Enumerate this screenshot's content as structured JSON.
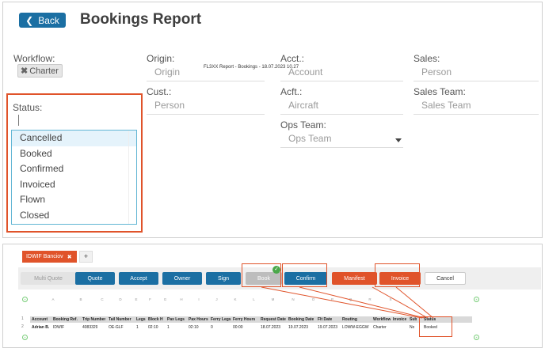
{
  "header": {
    "back_label": "Back",
    "title": "Bookings Report"
  },
  "filters": {
    "workflow_label": "Workflow:",
    "workflow_chip": "Charter",
    "origin_label": "Origin:",
    "origin_placeholder": "Origin",
    "cust_label": "Cust.:",
    "cust_placeholder": "Person",
    "acct_label": "Acct.:",
    "acct_placeholder": "Account",
    "acft_label": "Acft.:",
    "acft_placeholder": "Aircraft",
    "ops_label": "Ops Team:",
    "ops_placeholder": "Ops Team",
    "sales_label": "Sales:",
    "sales_placeholder": "Person",
    "sales_team_label": "Sales Team:",
    "sales_team_placeholder": "Sales Team",
    "status_label": "Status:",
    "status_options": [
      "Cancelled",
      "Booked",
      "Confirmed",
      "Invoiced",
      "Flown",
      "Closed"
    ]
  },
  "workbook": {
    "tab_label": "IDWIF Banciov",
    "add_tab": "+",
    "toolbar": {
      "multi_quote": "Multi Quote",
      "quote": "Quote",
      "accept": "Accept",
      "owner": "Owner",
      "sign": "Sign",
      "book": "Book",
      "confirm": "Confirm",
      "manifest": "Manifest",
      "invoice": "Invoice",
      "cancel": "Cancel"
    },
    "columns": [
      "A",
      "B",
      "C",
      "D",
      "E",
      "F",
      "G",
      "H",
      "I",
      "J",
      "K",
      "L",
      "M",
      "N",
      "O",
      "P",
      "Q",
      "R",
      "S"
    ],
    "sheet_title": "FL3XX Report - Bookings - 18.07.2023 10.27",
    "headers": [
      "Account",
      "Booking Ref.",
      "Trip Number",
      "Tail Number",
      "Legs",
      "Block H",
      "Pax Legs",
      "Pax Hours",
      "Ferry Legs",
      "Ferry Hours",
      "Request Date",
      "Booking Date",
      "Flt Date",
      "Routing",
      "Workflow",
      "Invoice",
      "Sub",
      "Status"
    ],
    "row": [
      "Adrian B.",
      "IDWIF",
      "4083329",
      "OE-GLF",
      "1",
      "02:10",
      "1",
      "02:10",
      "0",
      "00:00",
      "18.07.2023",
      "19.07.2023",
      "19.07.2023",
      "LOWW-EGGW",
      "Charter",
      "",
      "No",
      "Booked"
    ],
    "row_nums": [
      "1",
      "2"
    ]
  }
}
